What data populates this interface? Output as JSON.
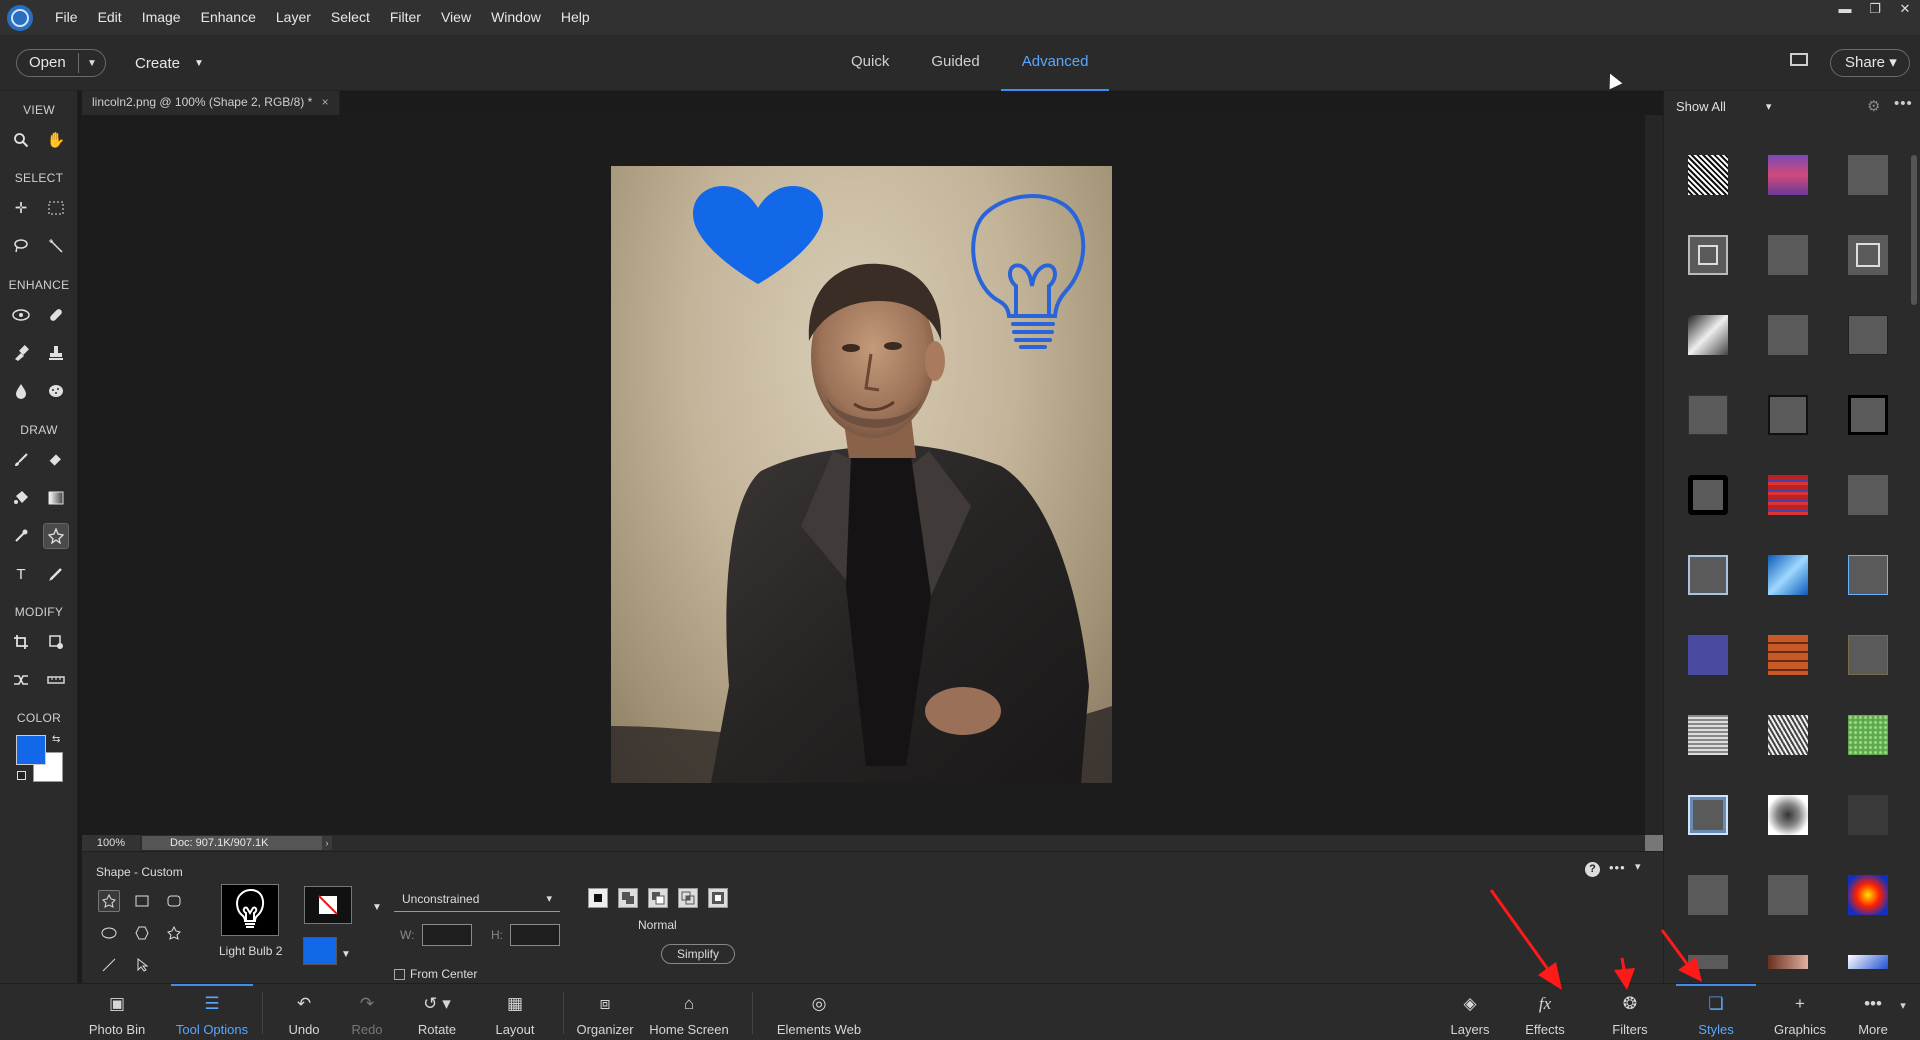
{
  "menubar": {
    "items": [
      "File",
      "Edit",
      "Image",
      "Enhance",
      "Layer",
      "Select",
      "Filter",
      "View",
      "Window",
      "Help"
    ],
    "window_controls": [
      "▬",
      "❐",
      "✕"
    ]
  },
  "topbar": {
    "open_label": "Open",
    "create_label": "Create",
    "modes": [
      "Quick",
      "Guided",
      "Advanced"
    ],
    "active_mode": "Advanced",
    "share_label": "Share ▾"
  },
  "toolbox": {
    "sections": [
      "VIEW",
      "SELECT",
      "ENHANCE",
      "DRAW",
      "MODIFY",
      "COLOR"
    ],
    "foreground_color": "#1268e8",
    "background_color": "#ffffff"
  },
  "document": {
    "tab_title": "lincoln2.png @ 100% (Shape 2, RGB/8) *",
    "tab_close": "×",
    "zoom": "100%",
    "doc_size": "Doc: 907.1K/907.1K"
  },
  "styles_panel": {
    "filter_label": "Show All"
  },
  "tool_options": {
    "title": "Shape - Custom",
    "shape_name": "Light Bulb 2",
    "fill_color": "#1268e8",
    "constraint": "Unconstrained",
    "width_label": "W:",
    "height_label": "H:",
    "from_center_label": "From Center",
    "mode_label": "Normal",
    "simplify_label": "Simplify"
  },
  "taskbar": {
    "photo_bin": "Photo Bin",
    "tool_options": "Tool Options",
    "undo": "Undo",
    "redo": "Redo",
    "rotate": "Rotate",
    "layout": "Layout",
    "organizer": "Organizer",
    "home_screen": "Home Screen",
    "elements_web": "Elements Web",
    "layers": "Layers",
    "effects": "Effects",
    "filters": "Filters",
    "styles": "Styles",
    "graphics": "Graphics",
    "more": "More"
  },
  "colors": {
    "accent": "#3d8ef0",
    "shape_blue": "#1268e8",
    "annotation_red": "#ff1a1a"
  }
}
